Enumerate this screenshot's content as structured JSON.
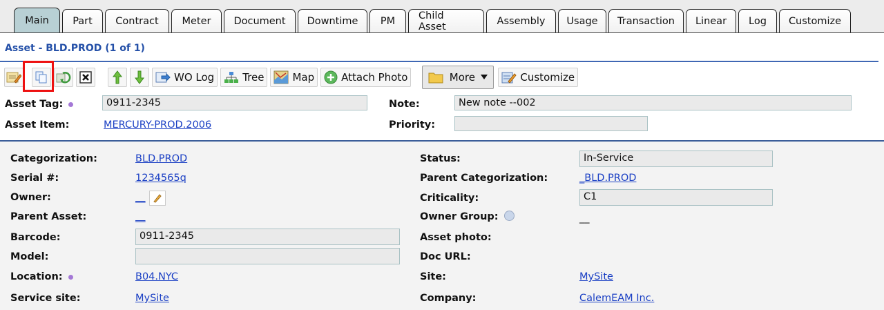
{
  "tabs": [
    "Main",
    "Part",
    "Contract",
    "Meter",
    "Document",
    "Downtime",
    "PM",
    "Child Asset",
    "Assembly",
    "Usage",
    "Transaction",
    "Linear",
    "Log",
    "Customize"
  ],
  "page_title": "Asset - BLD.PROD (1 of 1)",
  "toolbar": {
    "wo_log": "WO Log",
    "tree": "Tree",
    "map": "Map",
    "attach_photo": "Attach Photo",
    "more": "More",
    "customize": "Customize"
  },
  "header": {
    "asset_tag_label": "Asset Tag:",
    "asset_tag_value": "0911-2345",
    "asset_item_label": "Asset Item:",
    "asset_item_value": "MERCURY-PROD.2006",
    "note_label": "Note:",
    "note_value": "New note --002",
    "priority_label": "Priority:",
    "priority_value": ""
  },
  "form": {
    "categorization_label": "Categorization:",
    "categorization_value": "BLD.PROD",
    "serial_label": "Serial #:",
    "serial_value": "1234565q",
    "owner_label": "Owner:",
    "owner_value": "__",
    "parent_asset_label": "Parent Asset:",
    "parent_asset_value": "__",
    "barcode_label": "Barcode:",
    "barcode_value": "0911-2345",
    "model_label": "Model:",
    "model_value": "",
    "location_label": "Location:",
    "location_value": "B04.NYC",
    "service_site_label": "Service site:",
    "service_site_value": "MySite",
    "status_label": "Status:",
    "status_value": "In-Service",
    "parent_categorization_label": "Parent Categorization:",
    "parent_categorization_value": "_BLD.PROD",
    "criticality_label": "Criticality:",
    "criticality_value": "C1",
    "owner_group_label": "Owner Group:",
    "owner_group_value": "__",
    "asset_photo_label": "Asset photo:",
    "doc_url_label": "Doc URL:",
    "site_label": "Site:",
    "site_value": "MySite",
    "company_label": "Company:",
    "company_value": "CalemEAM Inc."
  },
  "colors": {
    "title_blue": "#2450a8",
    "link_blue": "#1a3fc4",
    "active_tab": "#b8d0d4",
    "highlight_red": "#e11111"
  }
}
